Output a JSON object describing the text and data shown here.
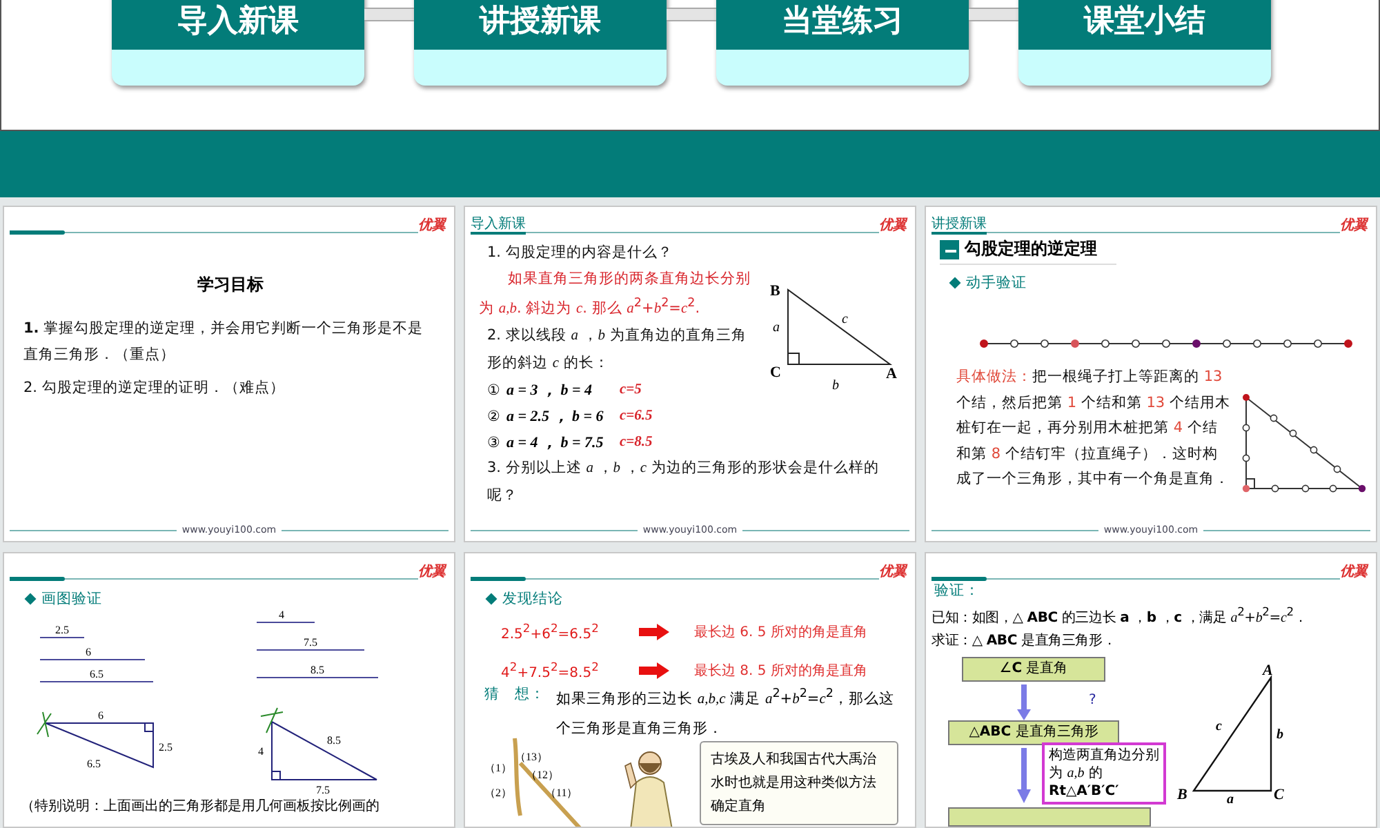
{
  "top_slide": {
    "tabs": [
      {
        "label": "导入新课"
      },
      {
        "label": "讲授新课"
      },
      {
        "label": "当堂练习"
      },
      {
        "label": "课堂小结"
      }
    ]
  },
  "slides": [
    {
      "kind": "objectives",
      "logo": "优翼",
      "title": "学习目标",
      "items": [
        "**1.** 掌握勾股定理的逆定理，并会用它判断一个三角形是不是直角三角形．（重点）",
        "2. 勾股定理的逆定理的证明．（难点）"
      ],
      "footer": "www.youyi100.com"
    },
    {
      "kind": "review",
      "header": "导入新课",
      "logo": "优翼",
      "question1": "1. 勾股定理的内容是什么？",
      "answer": "如果直角三角形的两条直角边长分别为 *a,b*. 斜边为 *c*. 那么 *a*$^{2}$+*b*$^{2}$=*c*$^{2}$.",
      "question2": "2. 求以线段 *a* ，*b* 为直角边的直角三角形的斜边 *c* 的长：",
      "cases": [
        {
          "mark": "①",
          "expr": "a = 3 ， b = 4",
          "answer": "c=5"
        },
        {
          "mark": "②",
          "expr": "a = 2.5 ， b = 6",
          "answer": "c=6.5"
        },
        {
          "mark": "③",
          "expr": "a = 4 ， b = 7.5",
          "answer": "c=8.5"
        }
      ],
      "question3": "3. 分别以上述 *a* ，*b* ，*c* 为边的三角形的形状会是什么样的呢？",
      "triangle_labels": {
        "B": "B",
        "C": "C",
        "A": "A",
        "a": "a",
        "b": "b",
        "c": "c"
      },
      "footer": "www.youyi100.com"
    },
    {
      "kind": "rope",
      "header": "讲授新课",
      "logo": "优翼",
      "section": "勾股定理的逆定理",
      "bullet": "动手验证",
      "method": [
        {
          "text": "具体做法：",
          "emphasis": true
        },
        {
          "text": "把一根绳子打上等距离的 ",
          "emphasis": false
        },
        {
          "text": "13",
          "emphasis": true
        },
        {
          "text": " 个结，然后把第 ",
          "emphasis": false
        },
        {
          "text": "1",
          "emphasis": true
        },
        {
          "text": " 个结和第 ",
          "emphasis": false
        },
        {
          "text": "13",
          "emphasis": true
        },
        {
          "text": " 个结用木桩钉在一起，再分别用木桩把第 ",
          "emphasis": false
        },
        {
          "text": "4",
          "emphasis": true
        },
        {
          "text": " 个结和第 ",
          "emphasis": false
        },
        {
          "text": "8",
          "emphasis": true
        },
        {
          "text": " 个结钉牢（拉直绳子）．这时构成了一个三角形，其中有一个角是直角．",
          "emphasis": false
        }
      ],
      "footer": "www.youyi100.com"
    },
    {
      "kind": "drawing",
      "logo": "优翼",
      "bullet": "画图验证",
      "segment_groups": [
        [
          "2.5",
          "6",
          "6.5"
        ],
        [
          "4",
          "7.5",
          "8.5"
        ]
      ],
      "triangles": [
        [
          "6",
          "2.5",
          "6.5"
        ],
        [
          "4",
          "7.5",
          "8.5"
        ]
      ],
      "note": "（特别说明：上面画出的三角形都是用几何画板按比例画的"
    },
    {
      "kind": "conclusion",
      "logo": "优翼",
      "bullet": "发现结论",
      "results": [
        {
          "equation": "2.5$^{2}$+6$^{2}$=6.5$^{2}$",
          "conclusion": "最长边 6. 5 所对的角是直角"
        },
        {
          "equation": "4$^{2}$+7.5$^{2}$=8.5$^{2}$",
          "conclusion": "最长边 8. 5 所对的角是直角"
        }
      ],
      "guess_label": "猜　想：",
      "guess": "如果三角形的三边长 *a,b,c* 满足 *a*$^{2}$+*b*$^{2}$=*c*$^{2}$，那么这个三角形是直角三角形．",
      "rope_labels": [
        "（13）",
        "（1）",
        "（12）",
        "（2）",
        "（11）"
      ],
      "bubble": "古埃及人和我国古代大禹治水时也就是用这种类似方法确定直角"
    },
    {
      "kind": "proof",
      "logo": "优翼",
      "label": "验证：",
      "given": "已知：如图，△ **ABC** 的三边长 **a** ，**b** ，**c** ，满足 *a*$^{2}$+*b*$^{2}$=*c*$^{2}$．",
      "prove": "求证：△ **ABC** 是直角三角形．",
      "steps": [
        "∠**C** 是直角",
        "△**ABC** 是直角三角形"
      ],
      "question_mark": "?",
      "construct": "构造两直角边分别为 *a,b* 的 **Rt△A′B′C′**",
      "triangle_labels": {
        "A": "A",
        "B": "B",
        "C": "C",
        "a": "a",
        "b": "b",
        "c": "c"
      }
    }
  ]
}
